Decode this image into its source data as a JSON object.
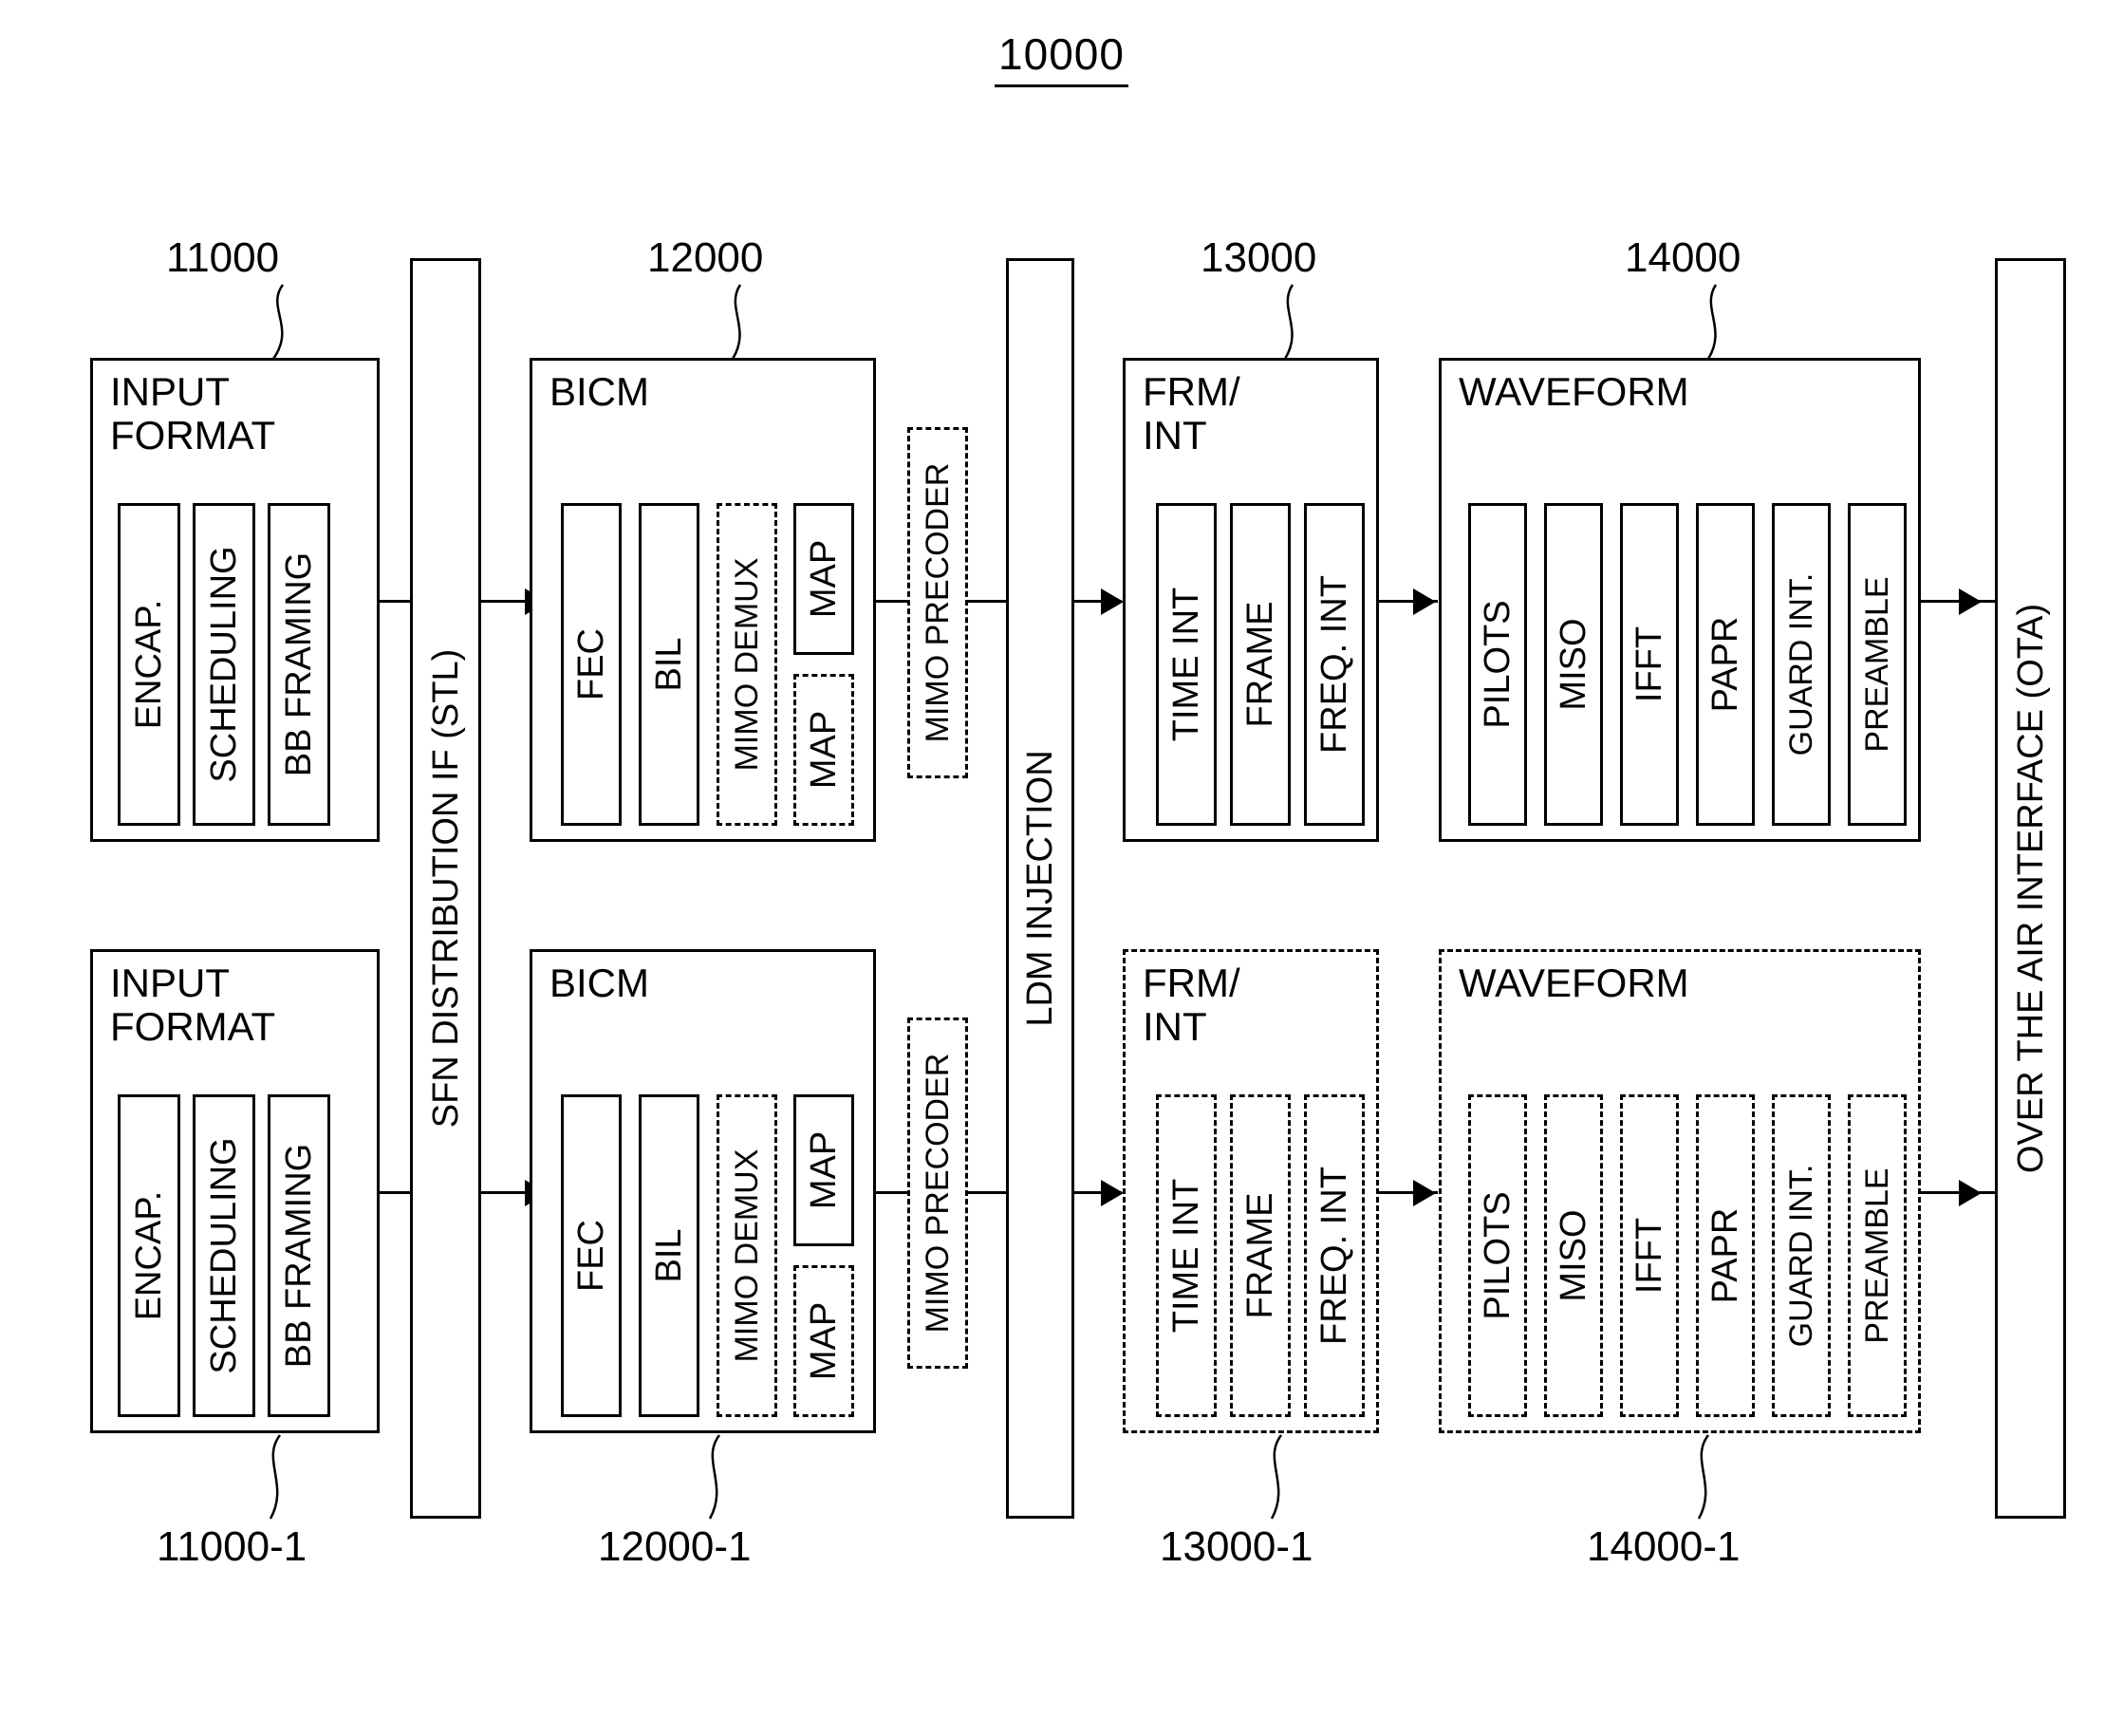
{
  "figure": {
    "title": "10000"
  },
  "reference_numerals": {
    "input_format_top": "11000",
    "bicm_top": "12000",
    "frm_int_top": "13000",
    "waveform_top": "14000",
    "input_format_bottom": "11000-1",
    "bicm_bottom": "12000-1",
    "frm_int_bottom": "13000-1",
    "waveform_bottom": "14000-1"
  },
  "vertical_bars": {
    "sfn": "SFN DISTRIBUTION IF (STL)",
    "ldm": "LDM INJECTION",
    "ota": "OVER THE AIR INTERFACE (OTA)"
  },
  "blocks": {
    "input_format": {
      "title": "INPUT\nFORMAT",
      "modules": [
        {
          "label": "ENCAP.",
          "style": "solid"
        },
        {
          "label": "SCHEDULING",
          "style": "solid"
        },
        {
          "label": "BB FRAMING",
          "style": "solid"
        }
      ]
    },
    "bicm": {
      "title": "BICM",
      "modules": [
        {
          "label": "FEC",
          "style": "solid"
        },
        {
          "label": "BIL",
          "style": "solid"
        },
        {
          "label": "MIMO DEMUX",
          "style": "dashed"
        }
      ],
      "map_upper": {
        "label": "MAP",
        "style": "solid"
      },
      "map_lower": {
        "label": "MAP",
        "style": "dashed"
      }
    },
    "mimo_precoder": {
      "label": "MIMO PRECODER",
      "style": "dashed"
    },
    "frm_int": {
      "title": "FRM/\nINT",
      "modules": [
        {
          "label": "TIME INT",
          "style": "solid"
        },
        {
          "label": "FRAME",
          "style": "solid"
        },
        {
          "label": "FREQ. INT",
          "style": "solid"
        }
      ]
    },
    "frm_int_lower": {
      "title": "FRM/\nINT",
      "modules": [
        {
          "label": "TIME INT",
          "style": "dashed"
        },
        {
          "label": "FRAME",
          "style": "dashed"
        },
        {
          "label": "FREQ. INT",
          "style": "dashed"
        }
      ]
    },
    "waveform": {
      "title": "WAVEFORM",
      "modules": [
        {
          "label": "PILOTS",
          "style": "solid"
        },
        {
          "label": "MISO",
          "style": "solid"
        },
        {
          "label": "IFFT",
          "style": "solid"
        },
        {
          "label": "PAPR",
          "style": "solid"
        },
        {
          "label": "GUARD INT.",
          "style": "solid"
        },
        {
          "label": "PREAMBLE",
          "style": "solid"
        }
      ]
    },
    "waveform_lower": {
      "title": "WAVEFORM",
      "modules": [
        {
          "label": "PILOTS",
          "style": "dashed"
        },
        {
          "label": "MISO",
          "style": "dashed"
        },
        {
          "label": "IFFT",
          "style": "dashed"
        },
        {
          "label": "PAPR",
          "style": "dashed"
        },
        {
          "label": "GUARD INT.",
          "style": "dashed"
        },
        {
          "label": "PREAMBLE",
          "style": "dashed"
        }
      ]
    }
  }
}
